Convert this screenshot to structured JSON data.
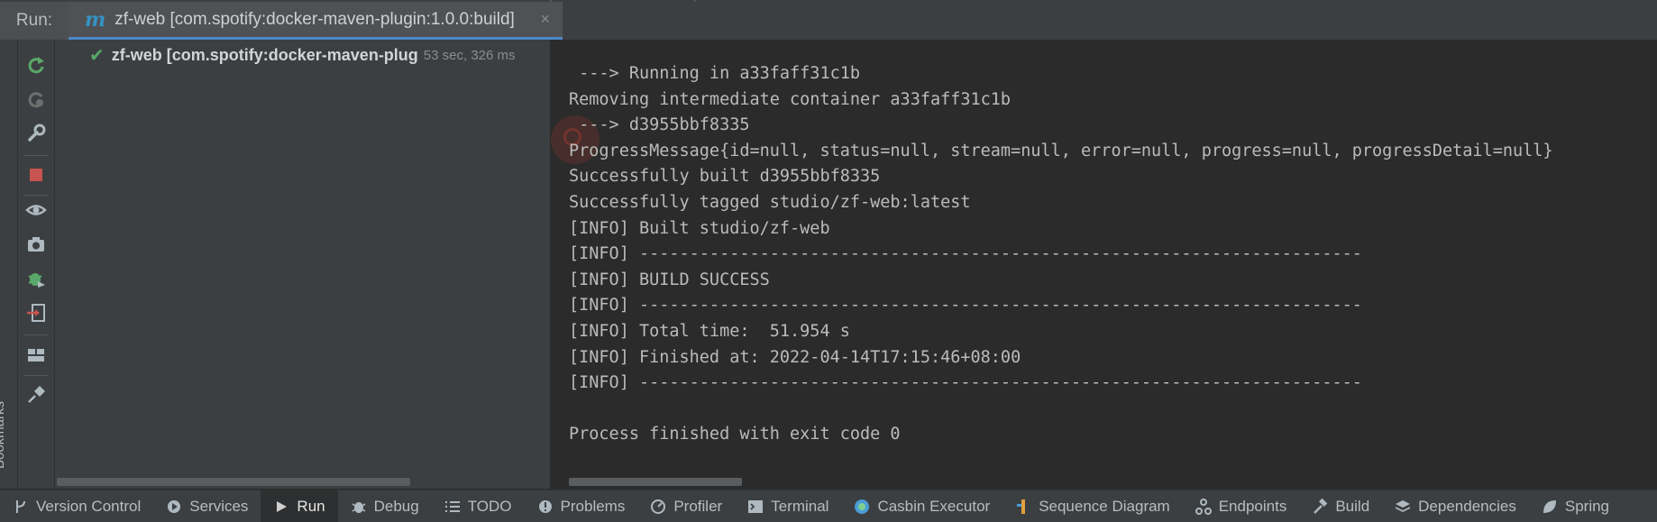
{
  "header": {
    "run_label": "Run:",
    "tab": {
      "icon": "maven-m-icon",
      "title": "zf-web [com.spotify:docker-maven-plugin:1.0.0:build]",
      "close_glyph": "×"
    }
  },
  "left_stripe": {
    "bookmarks_label": "Bookmarks"
  },
  "toolbar": {
    "buttons": [
      "rerun-icon",
      "rerun-failed-icon",
      "settings-wrench-icon",
      "stop-icon",
      "eye-icon",
      "camera-icon",
      "debug-bug-icon",
      "exit-import-icon",
      "layout-icon",
      "pin-icon"
    ]
  },
  "tree": {
    "row": {
      "title": "zf-web [com.spotify:docker-maven-plug",
      "time": "53 sec, 326 ms"
    }
  },
  "console": {
    "lines": [
      " ---> Running in a33faff31c1b",
      "Removing intermediate container a33faff31c1b",
      " ---> d3955bbf8335",
      "ProgressMessage{id=null, status=null, stream=null, error=null, progress=null, progressDetail=null}",
      "Successfully built d3955bbf8335",
      "Successfully tagged studio/zf-web:latest",
      "[INFO] Built studio/zf-web",
      "[INFO] ------------------------------------------------------------------------",
      "[INFO] BUILD SUCCESS",
      "[INFO] ------------------------------------------------------------------------",
      "[INFO] Total time:  51.954 s",
      "[INFO] Finished at: 2022-04-14T17:15:46+08:00",
      "[INFO] ------------------------------------------------------------------------",
      "",
      "Process finished with exit code 0"
    ]
  },
  "bottom_bar": {
    "items": [
      {
        "label": "Version Control",
        "icon": "branch-icon"
      },
      {
        "label": "Services",
        "icon": "services-icon"
      },
      {
        "label": "Run",
        "icon": "run-play-icon",
        "active": true
      },
      {
        "label": "Debug",
        "icon": "bug-icon"
      },
      {
        "label": "TODO",
        "icon": "list-icon"
      },
      {
        "label": "Problems",
        "icon": "problems-icon"
      },
      {
        "label": "Profiler",
        "icon": "profiler-icon"
      },
      {
        "label": "Terminal",
        "icon": "terminal-icon"
      },
      {
        "label": "Casbin Executor",
        "icon": "casbin-icon"
      },
      {
        "label": "Sequence Diagram",
        "icon": "sequence-icon"
      },
      {
        "label": "Endpoints",
        "icon": "endpoints-icon"
      },
      {
        "label": "Build",
        "icon": "hammer-icon"
      },
      {
        "label": "Dependencies",
        "icon": "layers-icon"
      },
      {
        "label": "Spring",
        "icon": "spring-leaf-icon"
      }
    ]
  },
  "colors": {
    "accent_tab_underline": "#4a88c7",
    "success_check": "#59a869",
    "stop_red": "#c75450",
    "rerun_green": "#59a869"
  }
}
